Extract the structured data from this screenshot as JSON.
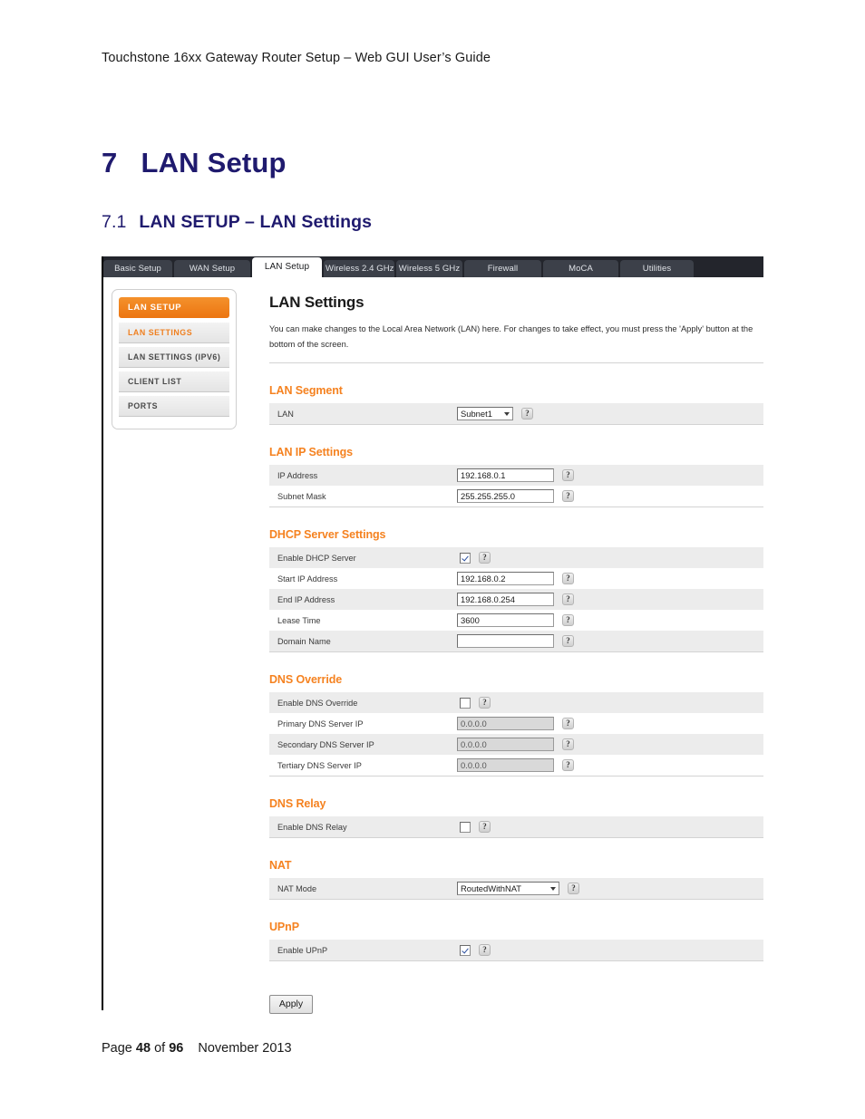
{
  "document": {
    "running_header": "Touchstone 16xx Gateway Router Setup – Web GUI User’s Guide",
    "chapter_number": "7",
    "chapter_title": "LAN Setup",
    "section_number": "7.1",
    "section_title": "LAN SETUP – LAN Settings",
    "footer": {
      "page_word": "Page",
      "page_number": "48",
      "of_word": "of",
      "total_pages": "96",
      "date": "November 2013"
    }
  },
  "router_ui": {
    "tabs": [
      {
        "label": "Basic Setup",
        "active": false
      },
      {
        "label": "WAN Setup",
        "active": false
      },
      {
        "label": "LAN Setup",
        "active": true
      },
      {
        "label": "Wireless 2.4 GHz",
        "active": false
      },
      {
        "label": "Wireless 5 GHz",
        "active": false
      },
      {
        "label": "Firewall",
        "active": false
      },
      {
        "label": "MoCA",
        "active": false
      },
      {
        "label": "Utilities",
        "active": false
      }
    ],
    "sidebar": {
      "header": "LAN SETUP",
      "items": [
        {
          "label": "LAN SETTINGS",
          "selected": true
        },
        {
          "label": "LAN SETTINGS (IPV6)",
          "selected": false
        },
        {
          "label": "CLIENT LIST",
          "selected": false
        },
        {
          "label": "PORTS",
          "selected": false
        }
      ]
    },
    "page": {
      "title": "LAN Settings",
      "description": "You can make changes to the Local Area Network (LAN) here. For changes to take effect, you must press the 'Apply' button at the bottom of the screen.",
      "help_icon_glyph": "?",
      "apply_label": "Apply"
    },
    "groups": {
      "lan_segment": {
        "title": "LAN Segment",
        "lan_label": "LAN",
        "lan_value": "Subnet1"
      },
      "lan_ip": {
        "title": "LAN IP Settings",
        "ip_address_label": "IP Address",
        "ip_address_value": "192.168.0.1",
        "subnet_mask_label": "Subnet Mask",
        "subnet_mask_value": "255.255.255.0"
      },
      "dhcp": {
        "title": "DHCP Server Settings",
        "enable_label": "Enable DHCP Server",
        "enable_checked": true,
        "start_ip_label": "Start IP Address",
        "start_ip_value": "192.168.0.2",
        "end_ip_label": "End IP Address",
        "end_ip_value": "192.168.0.254",
        "lease_time_label": "Lease Time",
        "lease_time_value": "3600",
        "domain_name_label": "Domain Name",
        "domain_name_value": ""
      },
      "dns_override": {
        "title": "DNS Override",
        "enable_label": "Enable DNS Override",
        "enable_checked": false,
        "primary_label": "Primary DNS Server IP",
        "primary_value": "0.0.0.0",
        "secondary_label": "Secondary DNS Server IP",
        "secondary_value": "0.0.0.0",
        "tertiary_label": "Tertiary DNS Server IP",
        "tertiary_value": "0.0.0.0"
      },
      "dns_relay": {
        "title": "DNS Relay",
        "enable_label": "Enable DNS Relay",
        "enable_checked": false
      },
      "nat": {
        "title": "NAT",
        "mode_label": "NAT Mode",
        "mode_value": "RoutedWithNAT"
      },
      "upnp": {
        "title": "UPnP",
        "enable_label": "Enable UPnP",
        "enable_checked": true
      }
    },
    "colors": {
      "accent_orange": "#f58220",
      "heading_navy": "#1f1a6e",
      "tabbar_dark": "#23252c",
      "row_gray": "#ececec"
    }
  }
}
